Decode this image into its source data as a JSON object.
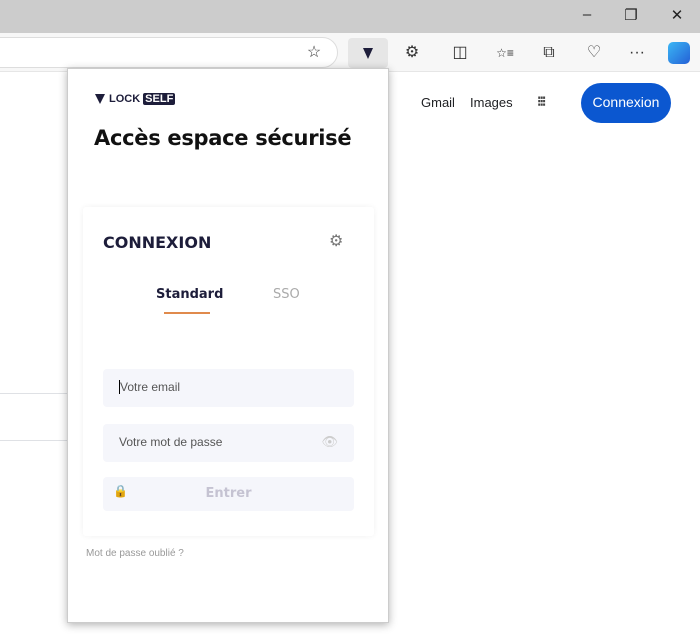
{
  "window": {
    "minimize": "–",
    "restore": "❐",
    "close": "✕"
  },
  "toolbar": {
    "favorite_icon": "☆",
    "extensions_icon": "⚙",
    "split_icon": "◫",
    "favorites_icon": "☆≡",
    "collections_icon": "⧉",
    "health_icon": "♡",
    "more": "···"
  },
  "google": {
    "gmail": "Gmail",
    "images": "Images",
    "apps_icon": "⋮⋮⋮",
    "signin": "Connexion"
  },
  "popup": {
    "logo_lock": "LOCK",
    "logo_self": "SELF",
    "title": "Accès espace sécurisé",
    "card_title": "CONNEXION",
    "tabs": [
      {
        "label": "Standard",
        "active": true
      },
      {
        "label": "SSO",
        "active": false
      }
    ],
    "email_placeholder": "Votre email",
    "password_placeholder": "Votre mot de passe",
    "submit": "Entrer",
    "forgot": "Mot de passe oublié ?"
  },
  "colors": {
    "accent": "#e08a4c",
    "primary": "#1d1d3a",
    "google_blue": "#0b57d0"
  }
}
